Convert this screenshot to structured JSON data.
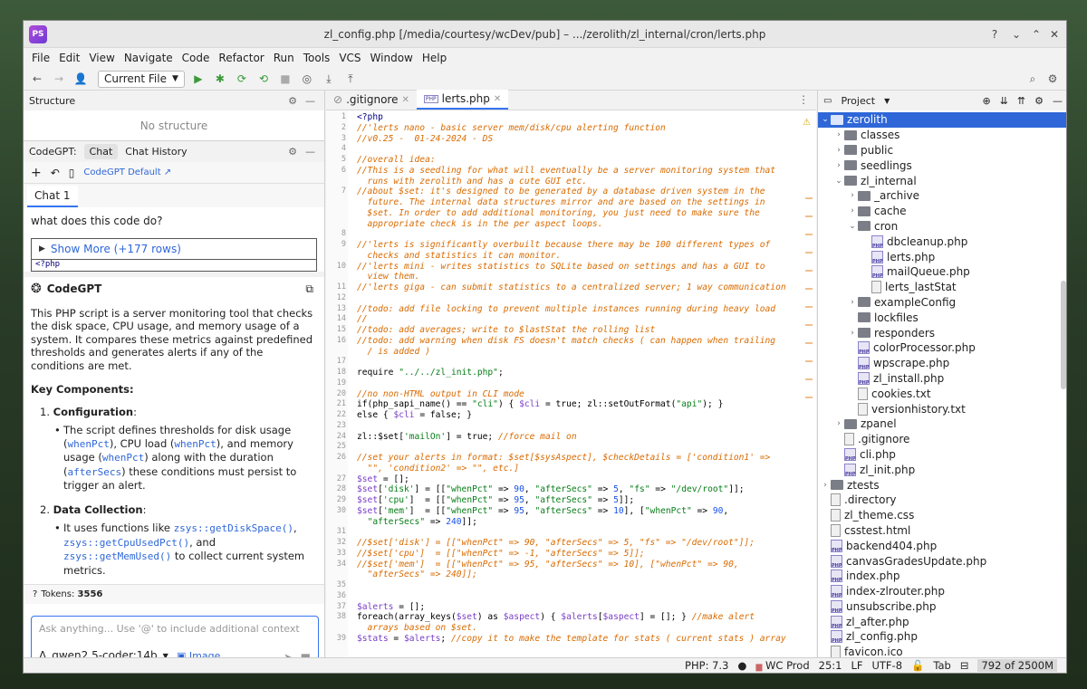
{
  "window": {
    "title": "zl_config.php [/media/courtesy/wcDev/pub] – .../zerolith/zl_internal/cron/lerts.php",
    "logo": "PS"
  },
  "menu": [
    "File",
    "Edit",
    "View",
    "Navigate",
    "Code",
    "Refactor",
    "Run",
    "Tools",
    "VCS",
    "Window",
    "Help"
  ],
  "toolbar": {
    "run_config": "Current File"
  },
  "structure": {
    "title": "Structure",
    "empty": "No structure"
  },
  "codegpt": {
    "tabs": [
      "CodeGPT:",
      "Chat",
      "Chat History"
    ],
    "default_label": "CodeGPT Default ↗",
    "chat_tab": "Chat 1",
    "question": "what does this code do?",
    "show_more": "Show More (+177 rows)",
    "snippet": "<?php",
    "bot_name": "CodeGPT",
    "answer_intro": "This PHP script is a server monitoring tool that checks the disk space, CPU usage, and memory usage of a system. It compares these metrics against predefined thresholds and generates alerts if any of the conditions are met.",
    "key_heading": "Key Components:",
    "item1_title": "Configuration",
    "item1_text": [
      "The script defines thresholds for disk usage (",
      "whenPct",
      "), CPU load (",
      "whenPct",
      "), and memory usage (",
      "whenPct",
      ") along with the duration (",
      "afterSecs",
      ") these conditions must persist to trigger an alert."
    ],
    "item2_title": "Data Collection",
    "item2_text": [
      "It uses functions like ",
      "zsys::getDiskSpace()",
      ", ",
      "zsys::getCpuUsedPct()",
      ", and ",
      "zsys::getMemUsed()",
      " to collect current system metrics."
    ],
    "tokens_label": "Tokens:",
    "tokens_value": "3556",
    "input_placeholder": "Ask anything... Use '@' to include additional context",
    "model": "qwen2.5-coder:14b",
    "image_label": "Image"
  },
  "editor_tabs": [
    ".gitignore",
    "lerts.php"
  ],
  "code_lines": [
    {
      "n": "1",
      "t": [
        [
          "kw",
          "<?php"
        ]
      ]
    },
    {
      "n": "2",
      "t": [
        [
          "cm",
          "//'lerts nano - basic server mem/disk/cpu alerting function"
        ]
      ]
    },
    {
      "n": "3",
      "t": [
        [
          "cm",
          "//v0.25 -  01-24-2024 - DS"
        ]
      ]
    },
    {
      "n": "4",
      "t": [
        [
          "df",
          ""
        ]
      ]
    },
    {
      "n": "5",
      "t": [
        [
          "cm",
          "//overall idea:"
        ]
      ]
    },
    {
      "n": "6",
      "t": [
        [
          "cm",
          "//This is a seedling for what will eventually be a server monitoring system that"
        ]
      ]
    },
    {
      "n": "",
      "t": [
        [
          "cm",
          "  runs with zerolith and has a cute GUI etc."
        ]
      ]
    },
    {
      "n": "7",
      "t": [
        [
          "cm",
          "//about $set: it's designed to be generated by a database driven system in the"
        ]
      ]
    },
    {
      "n": "",
      "t": [
        [
          "cm",
          "  future. The internal data structures mirror and are based on the settings in"
        ]
      ]
    },
    {
      "n": "",
      "t": [
        [
          "cm",
          "  $set. In order to add additional monitoring, you just need to make sure the"
        ]
      ]
    },
    {
      "n": "",
      "t": [
        [
          "cm",
          "  appropriate check is in the per aspect loops."
        ]
      ]
    },
    {
      "n": "8",
      "t": [
        [
          "df",
          ""
        ]
      ]
    },
    {
      "n": "9",
      "t": [
        [
          "cm",
          "//'lerts is significantly overbuilt because there may be 100 different types of"
        ]
      ]
    },
    {
      "n": "",
      "t": [
        [
          "cm",
          "  checks and statistics it can monitor."
        ]
      ]
    },
    {
      "n": "10",
      "t": [
        [
          "cm",
          "//'lerts mini - writes statistics to SQLite based on settings and has a GUI to"
        ]
      ]
    },
    {
      "n": "",
      "t": [
        [
          "cm",
          "  view them."
        ]
      ]
    },
    {
      "n": "11",
      "t": [
        [
          "cm",
          "//'lerts giga - can submit statistics to a centralized server; 1 way communication"
        ]
      ]
    },
    {
      "n": "12",
      "t": [
        [
          "df",
          ""
        ]
      ]
    },
    {
      "n": "13",
      "t": [
        [
          "cm",
          "//todo: add file locking to prevent multiple instances running during heavy load"
        ]
      ]
    },
    {
      "n": "14",
      "t": [
        [
          "cm",
          "//"
        ]
      ]
    },
    {
      "n": "15",
      "t": [
        [
          "cm",
          "//todo: add averages; write to $lastStat the rolling list"
        ]
      ]
    },
    {
      "n": "16",
      "t": [
        [
          "cm",
          "//todo: add warning when disk FS doesn't match checks ( can happen when trailing"
        ]
      ]
    },
    {
      "n": "",
      "t": [
        [
          "cm",
          "  / is added )"
        ]
      ]
    },
    {
      "n": "17",
      "t": [
        [
          "df",
          ""
        ]
      ]
    },
    {
      "n": "18",
      "t": [
        [
          "df",
          "require "
        ],
        [
          "st",
          "\"../../zl_init.php\""
        ],
        [
          "df",
          ";"
        ]
      ]
    },
    {
      "n": "19",
      "t": [
        [
          "df",
          ""
        ]
      ]
    },
    {
      "n": "20",
      "t": [
        [
          "cm",
          "//no non-HTML output in CLI mode"
        ]
      ]
    },
    {
      "n": "21",
      "t": [
        [
          "df",
          "if(php_sapi_name() == "
        ],
        [
          "st",
          "\"cli\""
        ],
        [
          "df",
          ") { "
        ],
        [
          "var",
          "$cli"
        ],
        [
          "df",
          " = true; zl::setOutFormat("
        ],
        [
          "st",
          "\"api\""
        ],
        [
          "df",
          "); }"
        ]
      ]
    },
    {
      "n": "22",
      "t": [
        [
          "df",
          "else { "
        ],
        [
          "var",
          "$cli"
        ],
        [
          "df",
          " = false; }"
        ]
      ]
    },
    {
      "n": "23",
      "t": [
        [
          "df",
          ""
        ]
      ]
    },
    {
      "n": "24",
      "t": [
        [
          "df",
          "zl::$set["
        ],
        [
          "st",
          "'mailOn'"
        ],
        [
          "df",
          "] = true; "
        ],
        [
          "cm",
          "//force mail on"
        ]
      ]
    },
    {
      "n": "25",
      "t": [
        [
          "df",
          ""
        ]
      ]
    },
    {
      "n": "26",
      "t": [
        [
          "cm",
          "//set your alerts in format: $set[$sysAspect], $checkDetails = ['condition1' =>"
        ]
      ]
    },
    {
      "n": "",
      "t": [
        [
          "cm",
          "  \"\", 'condition2' => \"\", etc.]"
        ]
      ]
    },
    {
      "n": "27",
      "t": [
        [
          "var",
          "$set"
        ],
        [
          "df",
          " = [];"
        ]
      ]
    },
    {
      "n": "28",
      "t": [
        [
          "var",
          "$set"
        ],
        [
          "df",
          "["
        ],
        [
          "st",
          "'disk'"
        ],
        [
          "df",
          "] = [["
        ],
        [
          "st",
          "\"whenPct\""
        ],
        [
          "df",
          " => "
        ],
        [
          "nm",
          "90"
        ],
        [
          "df",
          ", "
        ],
        [
          "st",
          "\"afterSecs\""
        ],
        [
          "df",
          " => "
        ],
        [
          "nm",
          "5"
        ],
        [
          "df",
          ", "
        ],
        [
          "st",
          "\"fs\""
        ],
        [
          "df",
          " => "
        ],
        [
          "st",
          "\"/dev/root\""
        ],
        [
          "df",
          "]];"
        ]
      ]
    },
    {
      "n": "29",
      "t": [
        [
          "var",
          "$set"
        ],
        [
          "df",
          "["
        ],
        [
          "st",
          "'cpu'"
        ],
        [
          "df",
          "]  = [["
        ],
        [
          "st",
          "\"whenPct\""
        ],
        [
          "df",
          " => "
        ],
        [
          "nm",
          "95"
        ],
        [
          "df",
          ", "
        ],
        [
          "st",
          "\"afterSecs\""
        ],
        [
          "df",
          " => "
        ],
        [
          "nm",
          "5"
        ],
        [
          "df",
          "]];"
        ]
      ]
    },
    {
      "n": "30",
      "t": [
        [
          "var",
          "$set"
        ],
        [
          "df",
          "["
        ],
        [
          "st",
          "'mem'"
        ],
        [
          "df",
          "]  = [["
        ],
        [
          "st",
          "\"whenPct\""
        ],
        [
          "df",
          " => "
        ],
        [
          "nm",
          "95"
        ],
        [
          "df",
          ", "
        ],
        [
          "st",
          "\"afterSecs\""
        ],
        [
          "df",
          " => "
        ],
        [
          "nm",
          "10"
        ],
        [
          "df",
          "], ["
        ],
        [
          "st",
          "\"whenPct\""
        ],
        [
          "df",
          " => "
        ],
        [
          "nm",
          "90"
        ],
        [
          "df",
          ","
        ]
      ]
    },
    {
      "n": "",
      "t": [
        [
          "df",
          "  "
        ],
        [
          "st",
          "\"afterSecs\""
        ],
        [
          "df",
          " => "
        ],
        [
          "nm",
          "240"
        ],
        [
          "df",
          "]];"
        ]
      ]
    },
    {
      "n": "31",
      "t": [
        [
          "df",
          ""
        ]
      ]
    },
    {
      "n": "32",
      "t": [
        [
          "cm",
          "//$set['disk'] = [[\"whenPct\" => 90, \"afterSecs\" => 5, \"fs\" => \"/dev/root\"]];"
        ]
      ]
    },
    {
      "n": "33",
      "t": [
        [
          "cm",
          "//$set['cpu']  = [[\"whenPct\" => -1, \"afterSecs\" => 5]];"
        ]
      ]
    },
    {
      "n": "34",
      "t": [
        [
          "cm",
          "//$set['mem']  = [[\"whenPct\" => 95, \"afterSecs\" => 10], [\"whenPct\" => 90,"
        ]
      ]
    },
    {
      "n": "",
      "t": [
        [
          "cm",
          "  \"afterSecs\" => 240]];"
        ]
      ]
    },
    {
      "n": "35",
      "t": [
        [
          "df",
          ""
        ]
      ]
    },
    {
      "n": "36",
      "t": [
        [
          "df",
          ""
        ]
      ]
    },
    {
      "n": "37",
      "t": [
        [
          "var",
          "$alerts"
        ],
        [
          "df",
          " = [];"
        ]
      ]
    },
    {
      "n": "38",
      "t": [
        [
          "df",
          "foreach(array_keys("
        ],
        [
          "var",
          "$set"
        ],
        [
          "df",
          ") as "
        ],
        [
          "var",
          "$aspect"
        ],
        [
          "df",
          ") { "
        ],
        [
          "var",
          "$alerts"
        ],
        [
          "df",
          "["
        ],
        [
          "var",
          "$aspect"
        ],
        [
          "df",
          "] = []; } "
        ],
        [
          "cm",
          "//make alert"
        ]
      ]
    },
    {
      "n": "",
      "t": [
        [
          "cm",
          "  arrays based on $set."
        ]
      ]
    },
    {
      "n": "39",
      "t": [
        [
          "var",
          "$stats"
        ],
        [
          "df",
          " = "
        ],
        [
          "var",
          "$alerts"
        ],
        [
          "df",
          "; "
        ],
        [
          "cm",
          "//copy it to make the template for stats ( current stats ) array"
        ]
      ]
    }
  ],
  "project": {
    "title": "Project",
    "tree": [
      {
        "d": 0,
        "type": "folder",
        "open": true,
        "label": "zerolith",
        "sel": true
      },
      {
        "d": 1,
        "type": "folder",
        "open": false,
        "label": "classes"
      },
      {
        "d": 1,
        "type": "folder",
        "open": false,
        "label": "public"
      },
      {
        "d": 1,
        "type": "folder",
        "open": false,
        "label": "seedlings"
      },
      {
        "d": 1,
        "type": "folder",
        "open": true,
        "label": "zl_internal"
      },
      {
        "d": 2,
        "type": "folder",
        "open": false,
        "label": "_archive"
      },
      {
        "d": 2,
        "type": "folder",
        "open": false,
        "label": "cache"
      },
      {
        "d": 2,
        "type": "folder",
        "open": true,
        "label": "cron"
      },
      {
        "d": 3,
        "type": "php",
        "label": "dbcleanup.php"
      },
      {
        "d": 3,
        "type": "php",
        "label": "lerts.php"
      },
      {
        "d": 3,
        "type": "php",
        "label": "mailQueue.php"
      },
      {
        "d": 3,
        "type": "file",
        "label": "lerts_lastStat"
      },
      {
        "d": 2,
        "type": "folder",
        "open": false,
        "label": "exampleConfig"
      },
      {
        "d": 2,
        "type": "folder",
        "noarrow": true,
        "label": "lockfiles"
      },
      {
        "d": 2,
        "type": "folder",
        "open": false,
        "label": "responders"
      },
      {
        "d": 2,
        "type": "php",
        "label": "colorProcessor.php"
      },
      {
        "d": 2,
        "type": "php",
        "label": "wpscrape.php"
      },
      {
        "d": 2,
        "type": "php",
        "label": "zl_install.php"
      },
      {
        "d": 2,
        "type": "file",
        "label": "cookies.txt"
      },
      {
        "d": 2,
        "type": "file",
        "label": "versionhistory.txt"
      },
      {
        "d": 1,
        "type": "folder",
        "open": false,
        "label": "zpanel"
      },
      {
        "d": 1,
        "type": "file",
        "label": ".gitignore"
      },
      {
        "d": 1,
        "type": "php",
        "label": "cli.php"
      },
      {
        "d": 1,
        "type": "php",
        "label": "zl_init.php"
      },
      {
        "d": 0,
        "type": "folder",
        "open": false,
        "label": "ztests"
      },
      {
        "d": 0,
        "type": "file",
        "label": ".directory"
      },
      {
        "d": 0,
        "type": "file",
        "label": "zl_theme.css"
      },
      {
        "d": 0,
        "type": "file",
        "label": "csstest.html"
      },
      {
        "d": 0,
        "type": "php",
        "label": "backend404.php"
      },
      {
        "d": 0,
        "type": "php",
        "label": "canvasGradesUpdate.php"
      },
      {
        "d": 0,
        "type": "php",
        "label": "index.php"
      },
      {
        "d": 0,
        "type": "php",
        "label": "index-zlrouter.php"
      },
      {
        "d": 0,
        "type": "php",
        "label": "unsubscribe.php"
      },
      {
        "d": 0,
        "type": "php",
        "label": "zl_after.php"
      },
      {
        "d": 0,
        "type": "php",
        "label": "zl_config.php"
      },
      {
        "d": 0,
        "type": "file",
        "label": "favicon.ico"
      }
    ]
  },
  "status": {
    "php": "PHP: 7.3",
    "server": "WC Prod",
    "pos": "25:1",
    "lf": "LF",
    "enc": "UTF-8",
    "indent": "Tab",
    "mem": "792 of 2500M"
  }
}
